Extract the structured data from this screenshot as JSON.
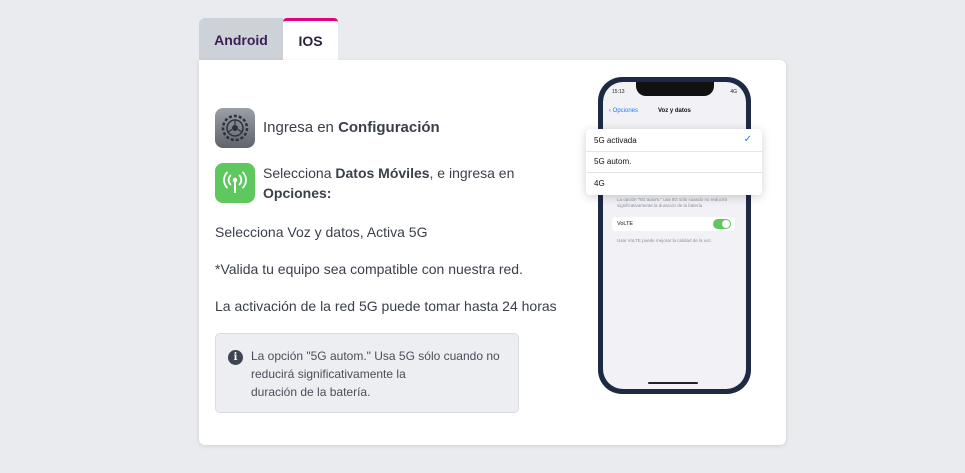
{
  "tabs": [
    {
      "label": "Android"
    },
    {
      "label": "IOS"
    }
  ],
  "steps": {
    "step1": {
      "prefix": "Ingresa en ",
      "bold": "Configuración"
    },
    "step2": {
      "prefix": "Selecciona ",
      "bold1": "Datos Móviles",
      "middle": ", e ingresa en ",
      "bold2": "Opciones:"
    }
  },
  "lines": [
    "Selecciona Voz y datos, Activa 5G",
    "*Valida tu equipo sea compatible con nuestra red.",
    "La activación de la red 5G puede tomar hasta 24 horas"
  ],
  "note": {
    "icon": "info-icon",
    "text_line1": "La opción \"5G autom.\" Usa 5G sólo cuando no",
    "text_line2": "reducirá significativamente la",
    "text_line3": "duración de la batería."
  },
  "phone": {
    "time": "15:13",
    "status": "4G",
    "back_label": "Opciones",
    "title": "Voz y datos",
    "description": "La opción \"5G autom.\" usa 5G sólo cuando no reducirá significativamente la duración de la batería",
    "volte_label": "VoLTE",
    "volte_on": true,
    "volte_description": "Usar VoLTE puede mejorar la calidad de la voz."
  },
  "popup": {
    "options": [
      "5G activada",
      "5G autom.",
      "4G"
    ],
    "selected_index": 0
  },
  "colors": {
    "accent_tab": "#e6007e",
    "tab_text": "#3b1d57",
    "settings_icon": "#7b8087",
    "antenna_icon": "#5ec75e",
    "ios_blue": "#1a7cff",
    "phone_frame": "#1c2a44"
  }
}
